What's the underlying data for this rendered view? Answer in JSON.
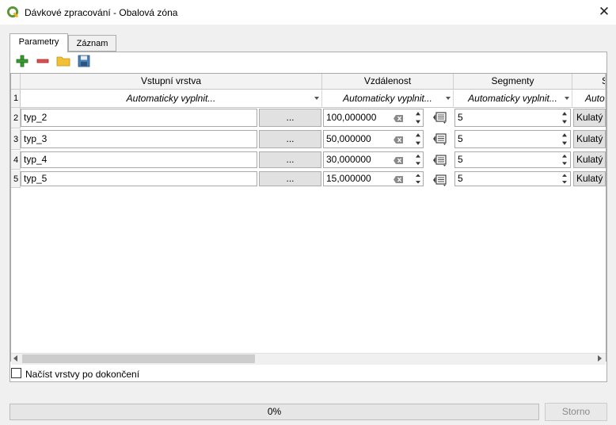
{
  "window": {
    "title": "Dávkové zpracování - Obalová zóna",
    "close_glyph": "✕"
  },
  "tabs": [
    {
      "label": "Parametry",
      "active": true
    },
    {
      "label": "Záznam",
      "active": false
    }
  ],
  "toolbar": {
    "icons": [
      "add-row-icon",
      "remove-row-icon",
      "open-folder-icon",
      "save-icon"
    ]
  },
  "table": {
    "columns": [
      "Vstupní vrstva",
      "Vzdálenost",
      "Segmenty",
      "S"
    ],
    "autofill_row_number": "1",
    "autofill_label": "Automaticky vyplnit...",
    "autofill_label_short": "Auto",
    "browse_label": "...",
    "rows": [
      {
        "num": "2",
        "layer": "typ_2",
        "distance": "100,000000",
        "segments": "5",
        "style": "Kulatý"
      },
      {
        "num": "3",
        "layer": "typ_3",
        "distance": "50,000000",
        "segments": "5",
        "style": "Kulatý"
      },
      {
        "num": "4",
        "layer": "typ_4",
        "distance": "30,000000",
        "segments": "5",
        "style": "Kulatý"
      },
      {
        "num": "5",
        "layer": "typ_5",
        "distance": "15,000000",
        "segments": "5",
        "style": "Kulatý"
      }
    ]
  },
  "load_layers": {
    "label": "Načíst vrstvy po dokončení",
    "checked": false
  },
  "progress": {
    "text": "0%",
    "value": 0
  },
  "cancel_label": "Storno",
  "colors": {
    "qgis_green": "#589632",
    "add_green": "#3a9c2f",
    "remove_red": "#d93a3a",
    "folder_yellow": "#f2c037",
    "save_blue": "#4a7fb5"
  }
}
